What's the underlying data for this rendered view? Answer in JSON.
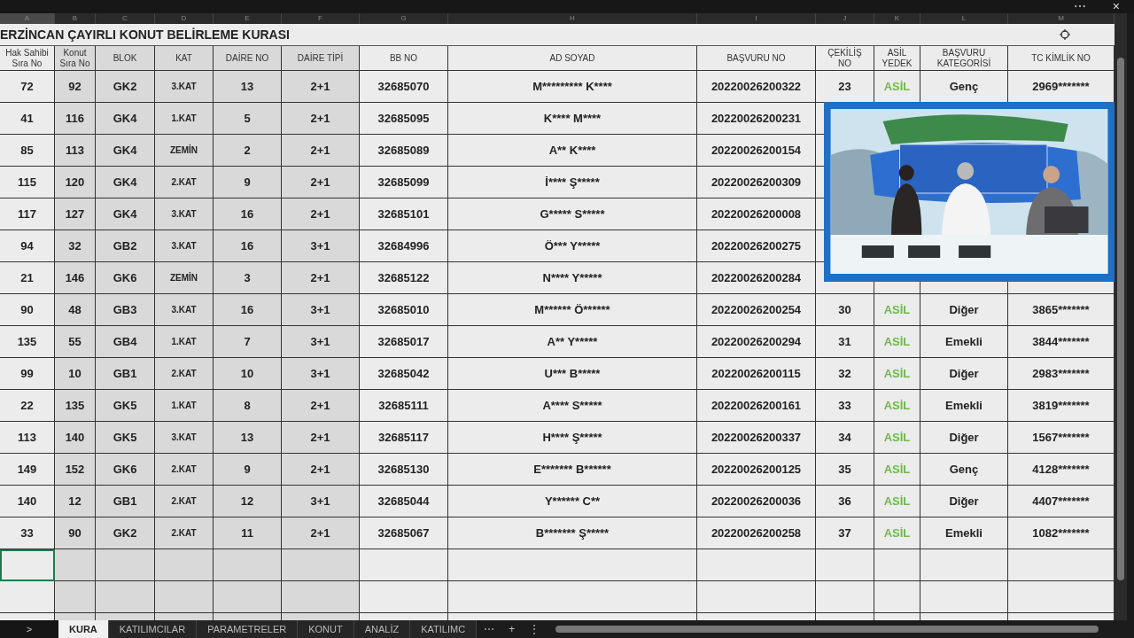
{
  "window_controls": {
    "more": "⋯",
    "close": "×"
  },
  "column_letters": [
    "A",
    "B",
    "C",
    "D",
    "E",
    "F",
    "G",
    "H",
    "I",
    "J",
    "K",
    "L",
    "M"
  ],
  "title": "ERZİNCAN ÇAYIRLI KONUT BELİRLEME KURASI",
  "headers": [
    "Hak Sahibi\nSıra No",
    "Konut\nSıra No",
    "BLOK",
    "KAT",
    "DAİRE NO",
    "DAİRE TİPİ",
    "BB NO",
    "AD SOYAD",
    "BAŞVURU NO",
    "ÇEKİLİŞ\nNO",
    "ASİL\nYEDEK",
    "BAŞVURU\nKATEGORİSİ",
    "TC KİMLİK NO"
  ],
  "rows": [
    [
      "72",
      "92",
      "GK2",
      "3.KAT",
      "13",
      "2+1",
      "32685070",
      "M********* K****",
      "20220026200322",
      "23",
      "ASİL",
      "Genç",
      "2969*******"
    ],
    [
      "41",
      "116",
      "GK4",
      "1.KAT",
      "5",
      "2+1",
      "32685095",
      "K**** M****",
      "20220026200231"
    ],
    [
      "85",
      "113",
      "GK4",
      "ZEMİN",
      "2",
      "2+1",
      "32685089",
      "A** K****",
      "20220026200154"
    ],
    [
      "115",
      "120",
      "GK4",
      "2.KAT",
      "9",
      "2+1",
      "32685099",
      "İ**** Ş*****",
      "20220026200309"
    ],
    [
      "117",
      "127",
      "GK4",
      "3.KAT",
      "16",
      "2+1",
      "32685101",
      "G***** S*****",
      "20220026200008"
    ],
    [
      "94",
      "32",
      "GB2",
      "3.KAT",
      "16",
      "3+1",
      "32684996",
      "Ö*** Y*****",
      "20220026200275"
    ],
    [
      "21",
      "146",
      "GK6",
      "ZEMİN",
      "3",
      "2+1",
      "32685122",
      "N**** Y*****",
      "20220026200284"
    ],
    [
      "90",
      "48",
      "GB3",
      "3.KAT",
      "16",
      "3+1",
      "32685010",
      "M****** Ö******",
      "20220026200254",
      "30",
      "ASİL",
      "Diğer",
      "3865*******"
    ],
    [
      "135",
      "55",
      "GB4",
      "1.KAT",
      "7",
      "3+1",
      "32685017",
      "A** Y*****",
      "20220026200294",
      "31",
      "ASİL",
      "Emekli",
      "3844*******"
    ],
    [
      "99",
      "10",
      "GB1",
      "2.KAT",
      "10",
      "3+1",
      "32685042",
      "U*** B*****",
      "20220026200115",
      "32",
      "ASİL",
      "Diğer",
      "2983*******"
    ],
    [
      "22",
      "135",
      "GK5",
      "1.KAT",
      "8",
      "2+1",
      "32685111",
      "A**** S*****",
      "20220026200161",
      "33",
      "ASİL",
      "Emekli",
      "3819*******"
    ],
    [
      "113",
      "140",
      "GK5",
      "3.KAT",
      "13",
      "2+1",
      "32685117",
      "H**** Ş*****",
      "20220026200337",
      "34",
      "ASİL",
      "Diğer",
      "1567*******"
    ],
    [
      "149",
      "152",
      "GK6",
      "2.KAT",
      "9",
      "2+1",
      "32685130",
      "E******* B******",
      "20220026200125",
      "35",
      "ASİL",
      "Genç",
      "4128*******"
    ],
    [
      "140",
      "12",
      "GB1",
      "2.KAT",
      "12",
      "3+1",
      "32685044",
      "Y****** C**",
      "20220026200036",
      "36",
      "ASİL",
      "Diğer",
      "4407*******"
    ],
    [
      "33",
      "90",
      "GK2",
      "2.KAT",
      "11",
      "2+1",
      "32685067",
      "B******* Ş*****",
      "20220026200258",
      "37",
      "ASİL",
      "Emekli",
      "1082*******"
    ]
  ],
  "empty_rows": [
    {
      "selected": true
    },
    {
      "selected": false
    },
    {
      "selected": false
    }
  ],
  "sheet_tabs": {
    "nav": ">",
    "tabs": [
      {
        "label": "KURA",
        "selected": true
      },
      {
        "label": "KATILIMCILAR",
        "selected": false
      },
      {
        "label": "PARAMETRELER",
        "selected": false
      },
      {
        "label": "KONUT",
        "selected": false
      },
      {
        "label": "ANALİZ",
        "selected": false
      },
      {
        "label": "KATILIMC",
        "selected": false
      }
    ],
    "more": "⋯",
    "add": "+",
    "menu": "⋮"
  }
}
